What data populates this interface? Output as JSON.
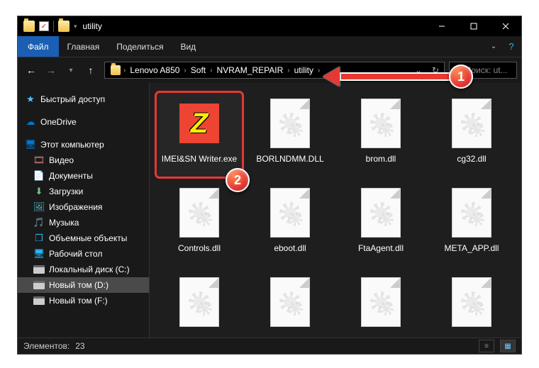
{
  "window": {
    "title": "utility"
  },
  "ribbon": {
    "file": "Файл",
    "tabs": [
      "Главная",
      "Поделиться",
      "Вид"
    ]
  },
  "breadcrumbs": [
    "Lenovo A850",
    "Soft",
    "NVRAM_REPAIR",
    "utility"
  ],
  "search": {
    "placeholder": "Поиск: ut..."
  },
  "sidebar": {
    "quick_access": "Быстрый доступ",
    "onedrive": "OneDrive",
    "this_pc": "Этот компьютер",
    "items": [
      {
        "label": "Видео",
        "ic": "ic-vid",
        "glyph": "🎞"
      },
      {
        "label": "Документы",
        "ic": "ic-doc",
        "glyph": "📄"
      },
      {
        "label": "Загрузки",
        "ic": "ic-dl",
        "glyph": "⬇"
      },
      {
        "label": "Изображения",
        "ic": "ic-img",
        "glyph": "🖼"
      },
      {
        "label": "Музыка",
        "ic": "ic-mus",
        "glyph": "🎵"
      },
      {
        "label": "Объемные объекты",
        "ic": "ic-3d",
        "glyph": "❒"
      },
      {
        "label": "Рабочий стол",
        "ic": "ic-desk",
        "glyph": "🖥"
      }
    ],
    "drives": [
      {
        "label": "Локальный диск (C:)"
      },
      {
        "label": "Новый том (D:)",
        "selected": true
      },
      {
        "label": "Новый том (F:)"
      }
    ]
  },
  "files": [
    {
      "name": "IMEI&SN Writer.exe",
      "type": "exe",
      "highlight": true
    },
    {
      "name": "BORLNDMM.DLL",
      "type": "dll"
    },
    {
      "name": "brom.dll",
      "type": "dll"
    },
    {
      "name": "cg32.dll",
      "type": "dll"
    },
    {
      "name": "Controls.dll",
      "type": "dll"
    },
    {
      "name": "eboot.dll",
      "type": "dll"
    },
    {
      "name": "FtaAgent.dll",
      "type": "dll"
    },
    {
      "name": "META_APP.dll",
      "type": "dll"
    },
    {
      "name": "",
      "type": "dll"
    },
    {
      "name": "",
      "type": "dll"
    },
    {
      "name": "",
      "type": "dll"
    },
    {
      "name": "",
      "type": "dll"
    }
  ],
  "status": {
    "label": "Элементов:",
    "count": "23"
  },
  "callouts": {
    "c1": "1",
    "c2": "2"
  }
}
